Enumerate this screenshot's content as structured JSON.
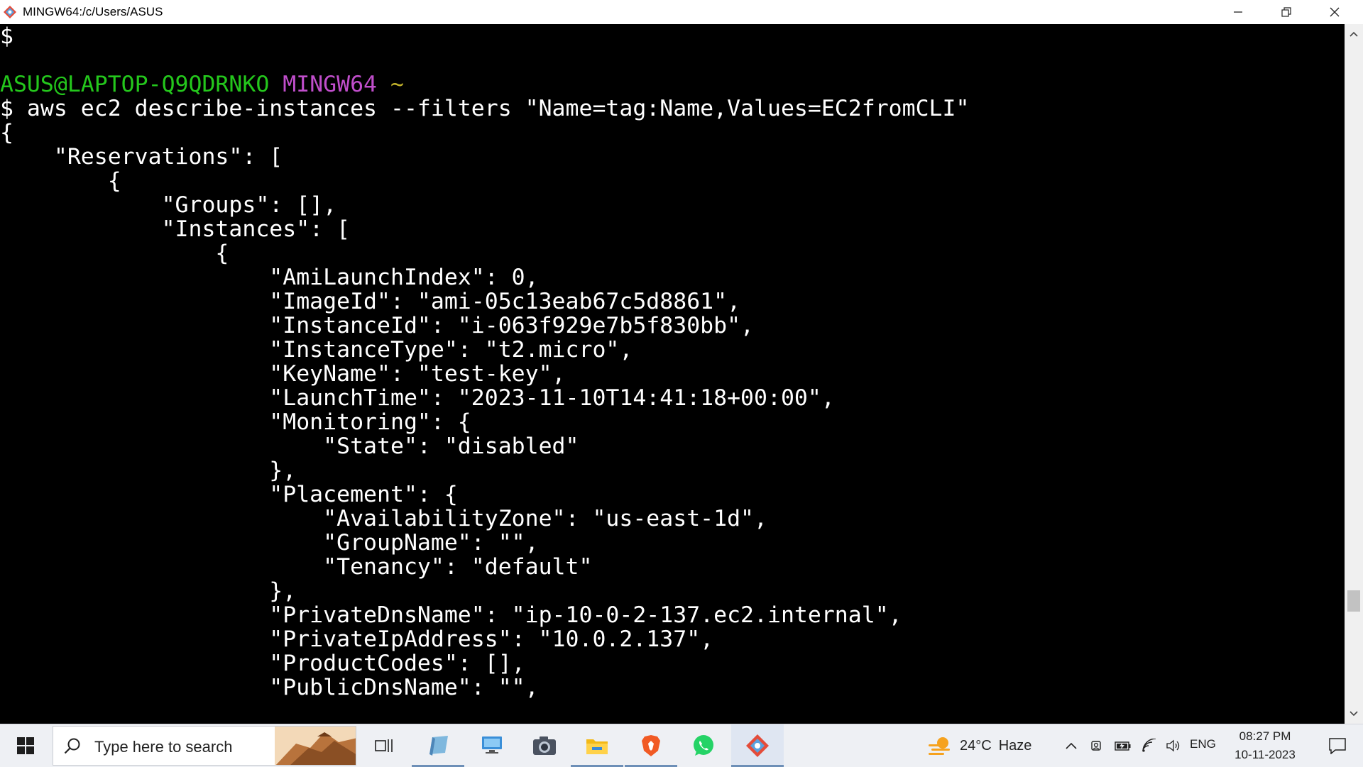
{
  "window": {
    "title": "MINGW64:/c/Users/ASUS",
    "icons": [
      "git-bash-icon",
      "minimize-icon",
      "restore-icon",
      "close-icon"
    ]
  },
  "terminal": {
    "prompt_user_host": "ASUS@LAPTOP-Q9QDRNKO",
    "prompt_shell": "MINGW64",
    "prompt_path": "~",
    "lines": [
      "$",
      "",
      "",
      "$ aws ec2 describe-instances --filters \"Name=tag:Name,Values=EC2fromCLI\"",
      "{",
      "    \"Reservations\": [",
      "        {",
      "            \"Groups\": [],",
      "            \"Instances\": [",
      "                {",
      "                    \"AmiLaunchIndex\": 0,",
      "                    \"ImageId\": \"ami-05c13eab67c5d8861\",",
      "                    \"InstanceId\": \"i-063f929e7b5f830bb\",",
      "                    \"InstanceType\": \"t2.micro\",",
      "                    \"KeyName\": \"test-key\",",
      "                    \"LaunchTime\": \"2023-11-10T14:41:18+00:00\",",
      "                    \"Monitoring\": {",
      "                        \"State\": \"disabled\"",
      "                    },",
      "                    \"Placement\": {",
      "                        \"AvailabilityZone\": \"us-east-1d\",",
      "                        \"GroupName\": \"\",",
      "                        \"Tenancy\": \"default\"",
      "                    },",
      "                    \"PrivateDnsName\": \"ip-10-0-2-137.ec2.internal\",",
      "                    \"PrivateIpAddress\": \"10.0.2.137\",",
      "                    \"ProductCodes\": [],",
      "                    \"PublicDnsName\": \"\","
    ],
    "colors": {
      "user_host": "#24c71c",
      "shell": "#c04ecb",
      "path": "#c2b22b",
      "text": "#ffffff",
      "background": "#000000"
    }
  },
  "taskbar": {
    "search_placeholder": "Type here to search",
    "apps": [
      "task-view-icon",
      "notepad-icon",
      "computer-icon",
      "camera-icon",
      "file-explorer-icon",
      "brave-browser-icon",
      "whatsapp-icon",
      "git-bash-icon"
    ],
    "weather_temp": "24°C",
    "weather_condition": "Haze",
    "language": "ENG",
    "time": "08:27 PM",
    "date": "10-11-2023"
  }
}
